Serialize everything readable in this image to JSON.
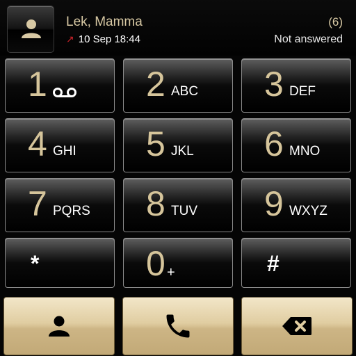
{
  "header": {
    "contact_name": "Lek, Mamma",
    "call_time": "10 Sep 18:44",
    "call_count": "(6)",
    "call_status": "Not answered",
    "call_direction_icon": "outgoing-call-arrow-icon"
  },
  "keypad": {
    "keys": [
      {
        "digit": "1",
        "letters": ""
      },
      {
        "digit": "2",
        "letters": "ABC"
      },
      {
        "digit": "3",
        "letters": "DEF"
      },
      {
        "digit": "4",
        "letters": "GHI"
      },
      {
        "digit": "5",
        "letters": "JKL"
      },
      {
        "digit": "6",
        "letters": "MNO"
      },
      {
        "digit": "7",
        "letters": "PQRS"
      },
      {
        "digit": "8",
        "letters": "TUV"
      },
      {
        "digit": "9",
        "letters": "WXYZ"
      },
      {
        "digit": "*",
        "letters": ""
      },
      {
        "digit": "0",
        "letters": "+"
      },
      {
        "digit": "#",
        "letters": ""
      }
    ]
  },
  "actions": {
    "contacts_icon": "person-icon",
    "call_icon": "phone-icon",
    "delete_icon": "backspace-icon"
  },
  "colors": {
    "accent_gold": "#d6c59b",
    "button_gold": "#e0cda1",
    "missed_red": "#d0232a",
    "background": "#050505"
  }
}
